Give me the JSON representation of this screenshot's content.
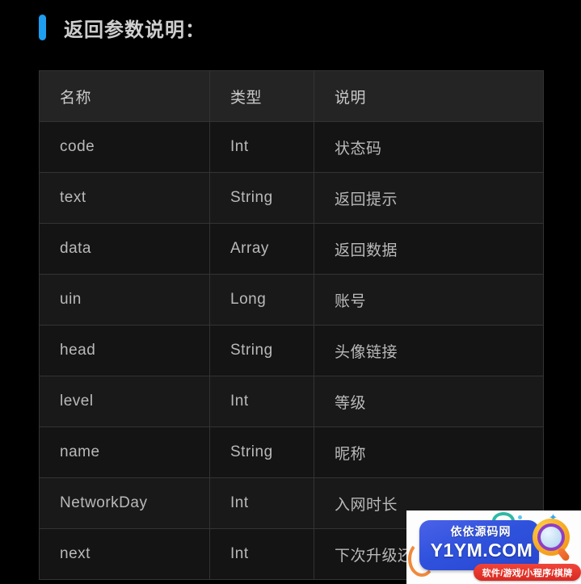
{
  "section": {
    "title": "返回参数说明：",
    "accent_color": "#1e9ef0"
  },
  "table": {
    "headers": [
      "名称",
      "类型",
      "说明"
    ],
    "rows": [
      {
        "name": "code",
        "type": "Int",
        "desc": "状态码"
      },
      {
        "name": "text",
        "type": "String",
        "desc": "返回提示"
      },
      {
        "name": "data",
        "type": "Array",
        "desc": "返回数据"
      },
      {
        "name": "uin",
        "type": "Long",
        "desc": "账号"
      },
      {
        "name": "head",
        "type": "String",
        "desc": "头像链接"
      },
      {
        "name": "level",
        "type": "Int",
        "desc": "等级"
      },
      {
        "name": "name",
        "type": "String",
        "desc": "昵称"
      },
      {
        "name": "NetworkDay",
        "type": "Int",
        "desc": "入网时长"
      },
      {
        "name": "next",
        "type": "Int",
        "desc": "下次升级还"
      }
    ]
  },
  "watermark": {
    "cn_name": "依依源码网",
    "domain": "Y1YM.COM",
    "badge": "软件/游戏/小程序/棋牌",
    "star": "✦"
  }
}
